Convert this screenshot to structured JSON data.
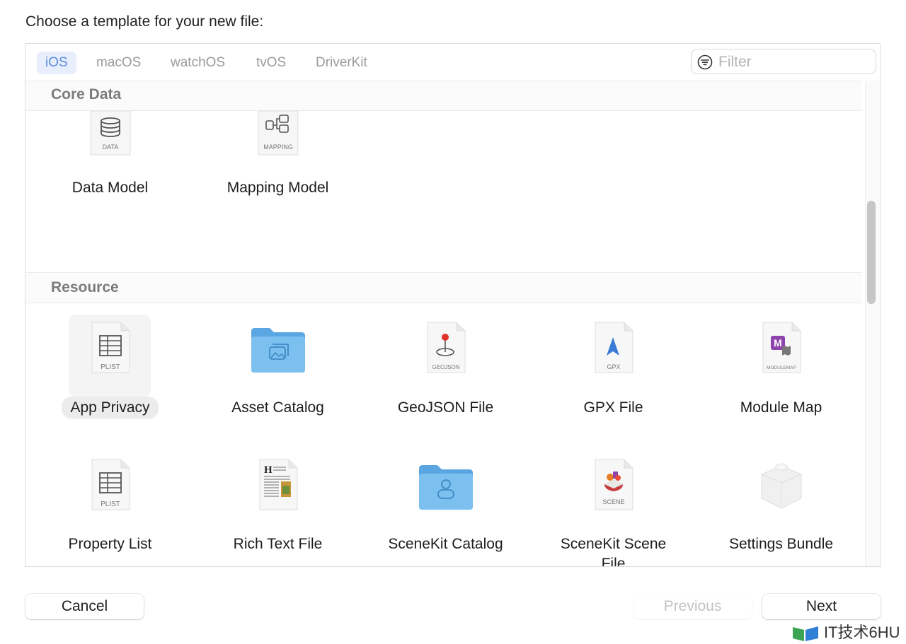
{
  "prompt": "Choose a template for your new file:",
  "tabs": [
    "iOS",
    "macOS",
    "watchOS",
    "tvOS",
    "DriverKit"
  ],
  "filter": {
    "placeholder": "Filter"
  },
  "sections": [
    {
      "title": "Core Data",
      "items": [
        {
          "label": "Data Model",
          "icon_text": "DATA",
          "icon": "database-icon"
        },
        {
          "label": "Mapping Model",
          "icon_text": "MAPPING",
          "icon": "mapping-icon"
        }
      ]
    },
    {
      "title": "Resource",
      "items": [
        {
          "label": "App Privacy",
          "icon_text": "PLIST",
          "icon": "plist-icon",
          "selected": true
        },
        {
          "label": "Asset Catalog",
          "icon": "folder-icon"
        },
        {
          "label": "GeoJSON File",
          "icon_text": "GEOJSON",
          "icon": "geojson-icon"
        },
        {
          "label": "GPX File",
          "icon_text": "GPX",
          "icon": "gpx-icon"
        },
        {
          "label": "Module Map",
          "icon_text": "MODULEMAP",
          "icon": "modulemap-icon"
        },
        {
          "label": "Property List",
          "icon_text": "PLIST",
          "icon": "plist-icon"
        },
        {
          "label": "Rich Text File",
          "icon": "richtext-icon"
        },
        {
          "label": "SceneKit Catalog",
          "icon": "folder-icon"
        },
        {
          "label_line1": "SceneKit Scene",
          "label_line2": "File",
          "icon_text": "SCENE",
          "icon": "scene-icon"
        },
        {
          "label": "Settings Bundle",
          "icon": "bundle-icon"
        }
      ]
    }
  ],
  "buttons": {
    "cancel": "Cancel",
    "previous": "Previous",
    "next": "Next"
  },
  "watermark": "IT技术6HU",
  "colors": {
    "accent": "#5b8ce0",
    "folder": "#6cb3ea",
    "modulemap": "#8e44ad",
    "pin": "#e0342a",
    "gpx": "#3a7bd5"
  }
}
